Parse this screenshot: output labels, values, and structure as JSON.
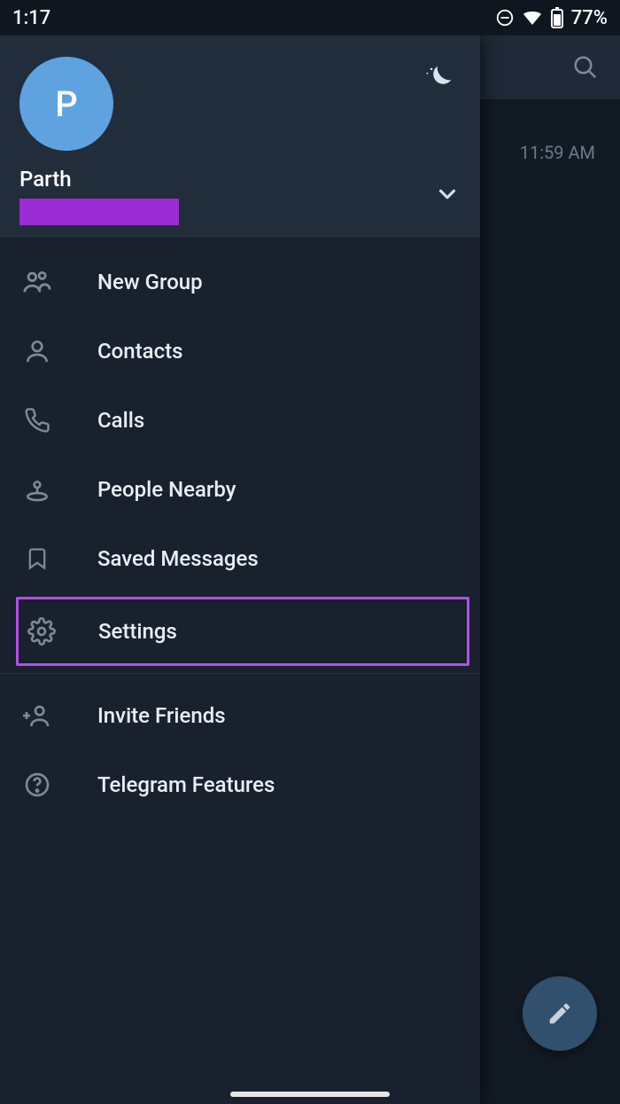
{
  "statusbar": {
    "time": "1:17",
    "battery": "77%"
  },
  "chat": {
    "time": "11:59 AM"
  },
  "profile": {
    "avatar_initial": "P",
    "name": "Parth"
  },
  "menu": {
    "new_group": "New Group",
    "contacts": "Contacts",
    "calls": "Calls",
    "people_nearby": "People Nearby",
    "saved_messages": "Saved Messages",
    "settings": "Settings",
    "invite_friends": "Invite Friends",
    "telegram_features": "Telegram Features"
  }
}
